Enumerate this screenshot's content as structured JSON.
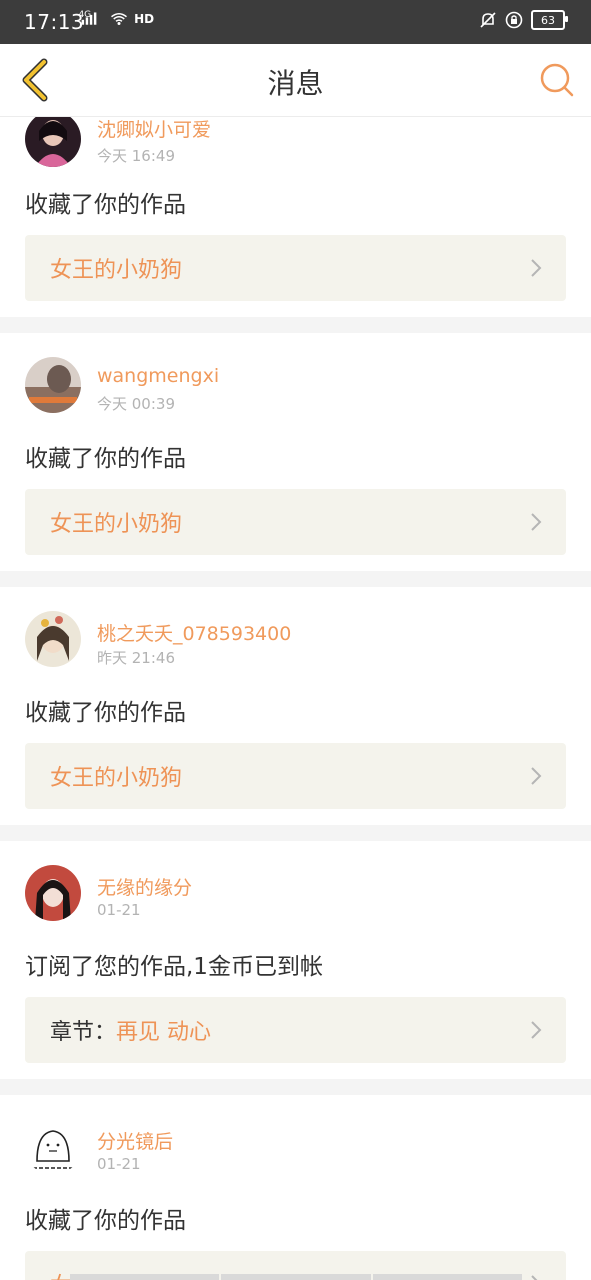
{
  "status_bar": {
    "time": "17:13",
    "network": "4G",
    "hd": "HD",
    "battery": "63"
  },
  "header": {
    "title": "消息"
  },
  "messages": [
    {
      "username": "沈卿姒小可爱",
      "time": "今天 16:49",
      "action": "收藏了你的作品",
      "link_prefix": "",
      "link_title": "女王的小奶狗"
    },
    {
      "username": "wangmengxi",
      "time": "今天 00:39",
      "action": "收藏了你的作品",
      "link_prefix": "",
      "link_title": "女王的小奶狗"
    },
    {
      "username": "桃之夭夭_078593400",
      "time": "昨天 21:46",
      "action": "收藏了你的作品",
      "link_prefix": "",
      "link_title": "女王的小奶狗"
    },
    {
      "username": "无缘的缘分",
      "time": "01-21",
      "action": "订阅了您的作品,1金币已到帐",
      "link_prefix": "章节：",
      "link_title": "再见 动心"
    },
    {
      "username": "分光镜后",
      "time": "01-21",
      "action": "收藏了你的作品",
      "link_prefix": "",
      "link_title": "女王的小奶狗"
    }
  ],
  "colors": {
    "accent": "#f09a5c",
    "link_bg": "#f4f3ec",
    "back_icon": "#f2c230"
  },
  "icons": {
    "back": "back-chevron-icon",
    "search": "search-icon",
    "chevron": "chevron-right-icon"
  }
}
